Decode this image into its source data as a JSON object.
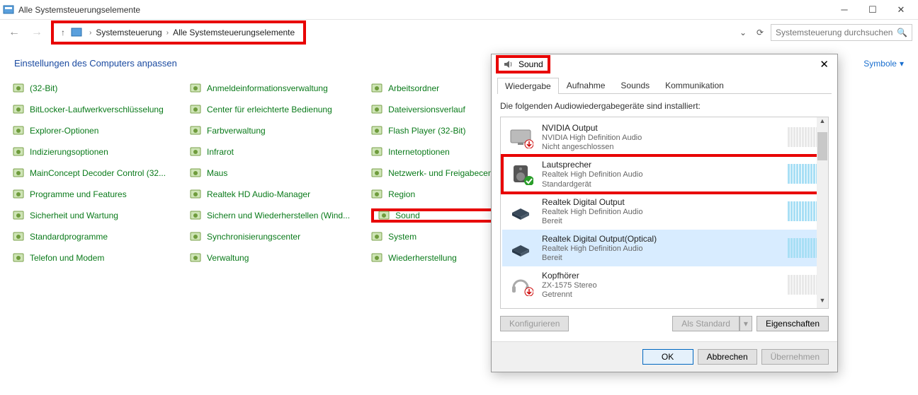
{
  "titlebar": {
    "title": "Alle Systemsteuerungselemente"
  },
  "breadcrumb": {
    "root": "Systemsteuerung",
    "leaf": "Alle Systemsteuerungselemente"
  },
  "search": {
    "placeholder": "Systemsteuerung durchsuchen"
  },
  "pageheader": {
    "title": "Einstellungen des Computers anpassen",
    "viewlabel": "Symbole"
  },
  "cp": {
    "col1": [
      "(32-Bit)",
      "BitLocker-Laufwerkverschlüsselung",
      "Explorer-Optionen",
      "Indizierungsoptionen",
      "MainConcept Decoder Control (32...",
      "Programme und Features",
      "Sicherheit und Wartung",
      "Standardprogramme",
      "Telefon und Modem"
    ],
    "col2": [
      "Anmeldeinformationsverwaltung",
      "Center für erleichterte Bedienung",
      "Farbverwaltung",
      "Infrarot",
      "Maus",
      "Realtek HD Audio-Manager",
      "Sichern und Wiederherstellen (Wind...",
      "Synchronisierungscenter",
      "Verwaltung"
    ],
    "col3": [
      "Arbeitsordner",
      "Dateiversionsverlauf",
      "Flash Player (32-Bit)",
      "Internetoptionen",
      "Netzwerk- und Freigabecenter",
      "Region",
      "Sound",
      "System",
      "Wiederherstellung"
    ]
  },
  "dialog": {
    "title": "Sound",
    "tabs": [
      "Wiedergabe",
      "Aufnahme",
      "Sounds",
      "Kommunikation"
    ],
    "hint": "Die folgenden Audiowiedergabegeräte sind installiert:",
    "devices": [
      {
        "name": "NVIDIA Output",
        "sub": "NVIDIA High Definition Audio",
        "status": "Nicht angeschlossen",
        "kind": "monitor",
        "badge": "down"
      },
      {
        "name": "Lautsprecher",
        "sub": "Realtek High Definition Audio",
        "status": "Standardgerät",
        "kind": "speaker",
        "badge": "check",
        "highlight": true
      },
      {
        "name": "Realtek Digital Output",
        "sub": "Realtek High Definition Audio",
        "status": "Bereit",
        "kind": "box"
      },
      {
        "name": "Realtek Digital Output(Optical)",
        "sub": "Realtek High Definition Audio",
        "status": "Bereit",
        "kind": "box",
        "selected": true
      },
      {
        "name": "Kopfhörer",
        "sub": "ZX-1575 Stereo",
        "status": "Getrennt",
        "kind": "headphones",
        "badge": "down"
      }
    ],
    "buttons": {
      "configure": "Konfigurieren",
      "setdefault": "Als Standard",
      "properties": "Eigenschaften",
      "ok": "OK",
      "cancel": "Abbrechen",
      "apply": "Übernehmen"
    }
  }
}
